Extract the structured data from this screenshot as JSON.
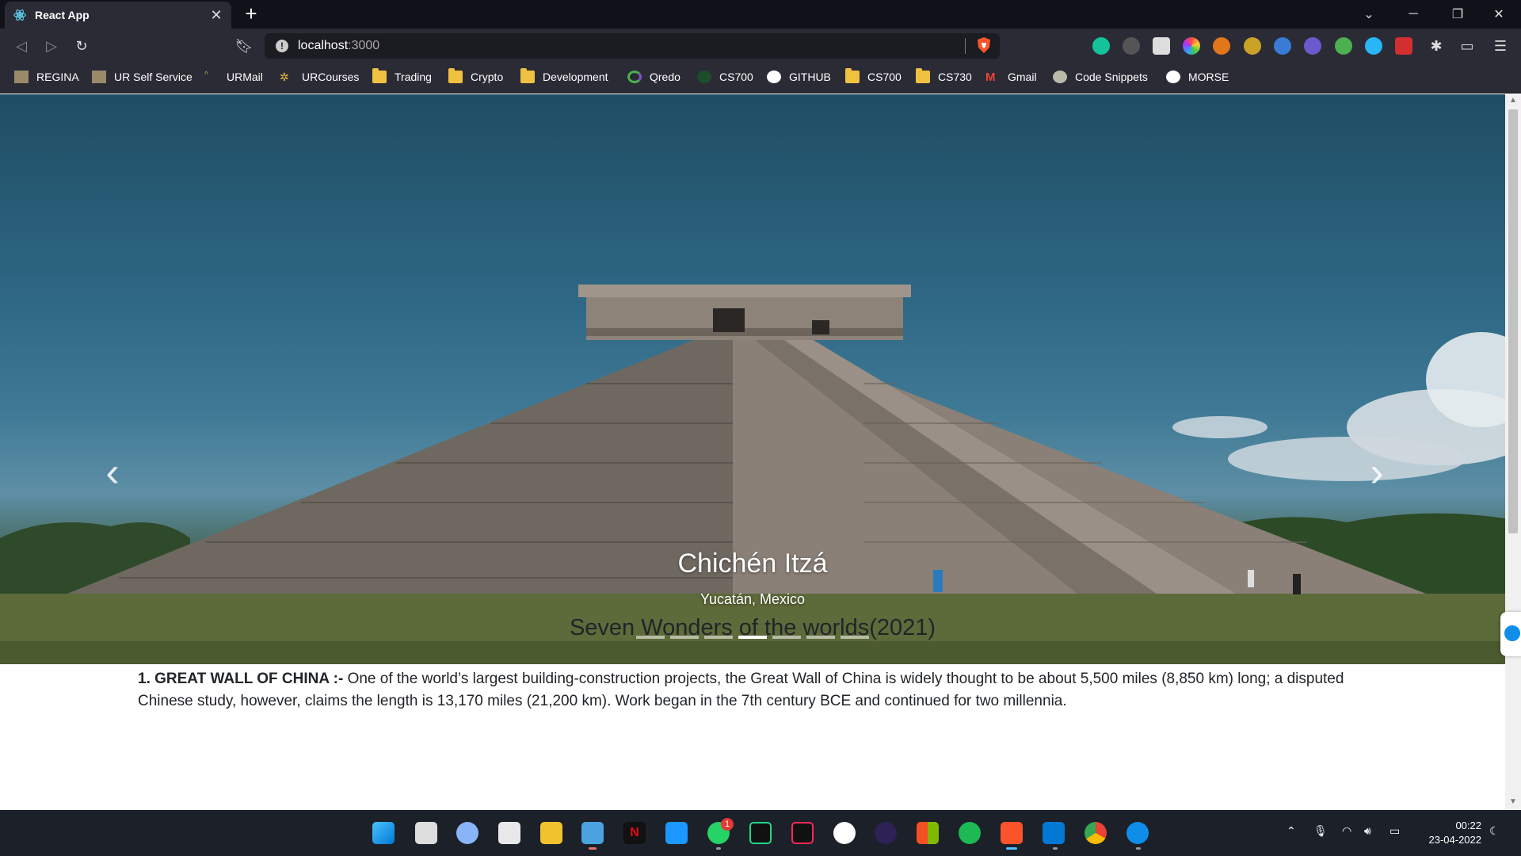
{
  "browser": {
    "tab_title": "React App",
    "url_host": "localhost",
    "url_port": ":3000",
    "bookmarks": [
      {
        "label": "REGINA",
        "icon": "image-favicon"
      },
      {
        "label": "UR Self Service",
        "icon": "image-favicon"
      },
      {
        "label": "URMail",
        "icon": "mail-favicon"
      },
      {
        "label": "URCourses",
        "icon": "courses-favicon"
      },
      {
        "label": "Trading",
        "icon": "folder-icon"
      },
      {
        "label": "Crypto",
        "icon": "folder-icon"
      },
      {
        "label": "Development",
        "icon": "folder-icon"
      },
      {
        "label": "Qredo",
        "icon": "qredo-favicon"
      },
      {
        "label": "CS700",
        "icon": "favicon"
      },
      {
        "label": "GITHUB",
        "icon": "github-icon"
      },
      {
        "label": "CS700",
        "icon": "folder-icon"
      },
      {
        "label": "CS730",
        "icon": "folder-icon"
      },
      {
        "label": "Gmail",
        "icon": "gmail-icon"
      },
      {
        "label": "Code Snippets",
        "icon": "avatar-favicon"
      },
      {
        "label": "MORSE",
        "icon": "github-icon"
      }
    ]
  },
  "carousel": {
    "slide_title": "Chichén Itzá",
    "slide_subtitle": "Yucatán, Mexico",
    "indicator_count": 7,
    "active_index": 3
  },
  "main": {
    "heading": "Seven Wonders of the worlds(2021)",
    "items": [
      {
        "title": "1. GREAT WALL OF CHINA :-",
        "text": " One of the world’s largest building-construction projects, the Great Wall of China is widely thought to be about 5,500 miles (8,850 km) long; a disputed Chinese study, however, claims the length is 13,170 miles (21,200 km). Work began in the 7th century BCE and continued for two millennia."
      }
    ]
  },
  "taskbar": {
    "whatsapp_badge": "1",
    "time": "00:22",
    "date": "23-04-2022"
  }
}
